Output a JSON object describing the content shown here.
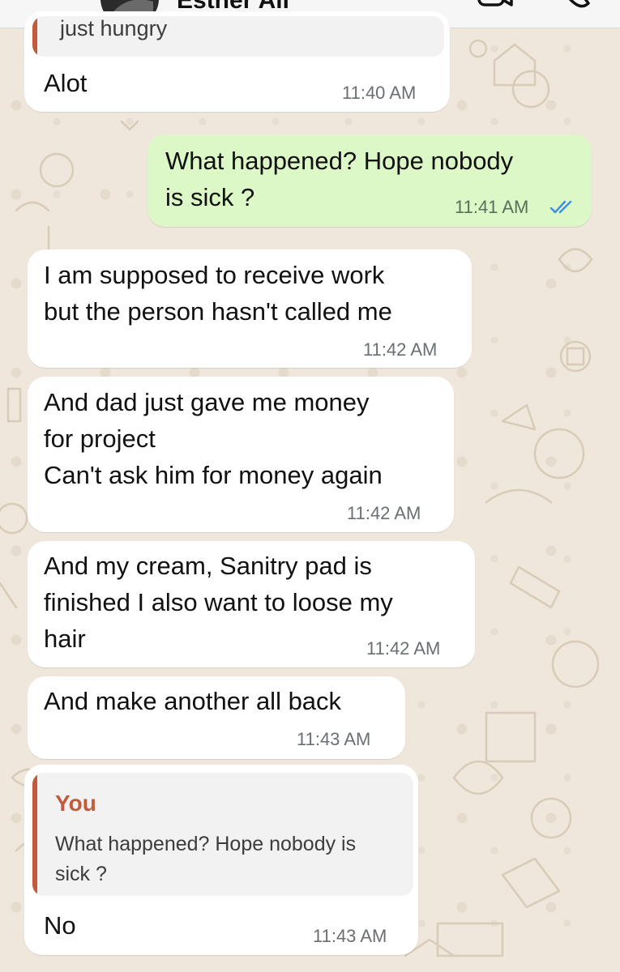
{
  "header": {
    "contact_name": "Esther Ali",
    "icons": [
      "chevron-left-icon",
      "video-call-icon",
      "phone-call-icon"
    ]
  },
  "messages": [
    {
      "direction": "in",
      "quoted_text_partial": "just hungry",
      "text_lines": [
        "Alot"
      ],
      "time": "11:40 AM"
    },
    {
      "direction": "out",
      "text_lines": [
        "What happened? Hope nobody",
        "is sick ?"
      ],
      "time": "11:41 AM",
      "status": "read"
    },
    {
      "direction": "in",
      "text_lines": [
        "I am supposed to receive work",
        "but the person hasn't called me"
      ],
      "time": "11:42 AM"
    },
    {
      "direction": "in",
      "text_lines": [
        "And dad just gave me money",
        "for project",
        "Can't ask him for money again"
      ],
      "time": "11:42 AM"
    },
    {
      "direction": "in",
      "text_lines": [
        "And my cream, Sanitry pad is",
        "finished I also want to loose my",
        "hair"
      ],
      "time": "11:42 AM"
    },
    {
      "direction": "in",
      "text_lines": [
        "And make another all back"
      ],
      "time": "11:43 AM"
    },
    {
      "direction": "in",
      "quote": {
        "author": "You",
        "text_lines": [
          "What happened? Hope nobody is",
          "sick ?"
        ]
      },
      "text_lines": [
        "No"
      ],
      "time": "11:43 AM"
    }
  ],
  "colors": {
    "wallpaper": "#efe7dc",
    "incoming_bubble": "#ffffff",
    "outgoing_bubble": "#dcf8c6",
    "quote_accent": "#c25b3c",
    "read_ticks": "#3c8ce7"
  }
}
